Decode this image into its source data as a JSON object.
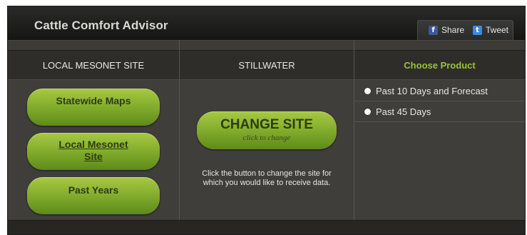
{
  "app": {
    "title": "Cattle Comfort Advisor"
  },
  "social": {
    "share_label": "Share",
    "tweet_label": "Tweet",
    "share_icon": "facebook-icon",
    "tweet_icon": "twitter-icon"
  },
  "columns": {
    "left_header": "LOCAL MESONET SITE",
    "middle_header": "STILLWATER",
    "right_header": "Choose Product"
  },
  "nav_buttons": [
    {
      "label": "Statewide Maps"
    },
    {
      "label": "Local Mesonet Site"
    },
    {
      "label": "Past Years"
    }
  ],
  "change_site": {
    "label": "CHANGE SITE",
    "sublabel": "click to change",
    "help_text": "Click the button to change the site for which you would like to receive data."
  },
  "products": [
    {
      "label": "Past 10 Days and Forecast"
    },
    {
      "label": "Past 45 Days"
    }
  ],
  "colors": {
    "accent_green": "#8cb82e",
    "header_green": "#9ac23c",
    "background": "#3f3e3a"
  }
}
